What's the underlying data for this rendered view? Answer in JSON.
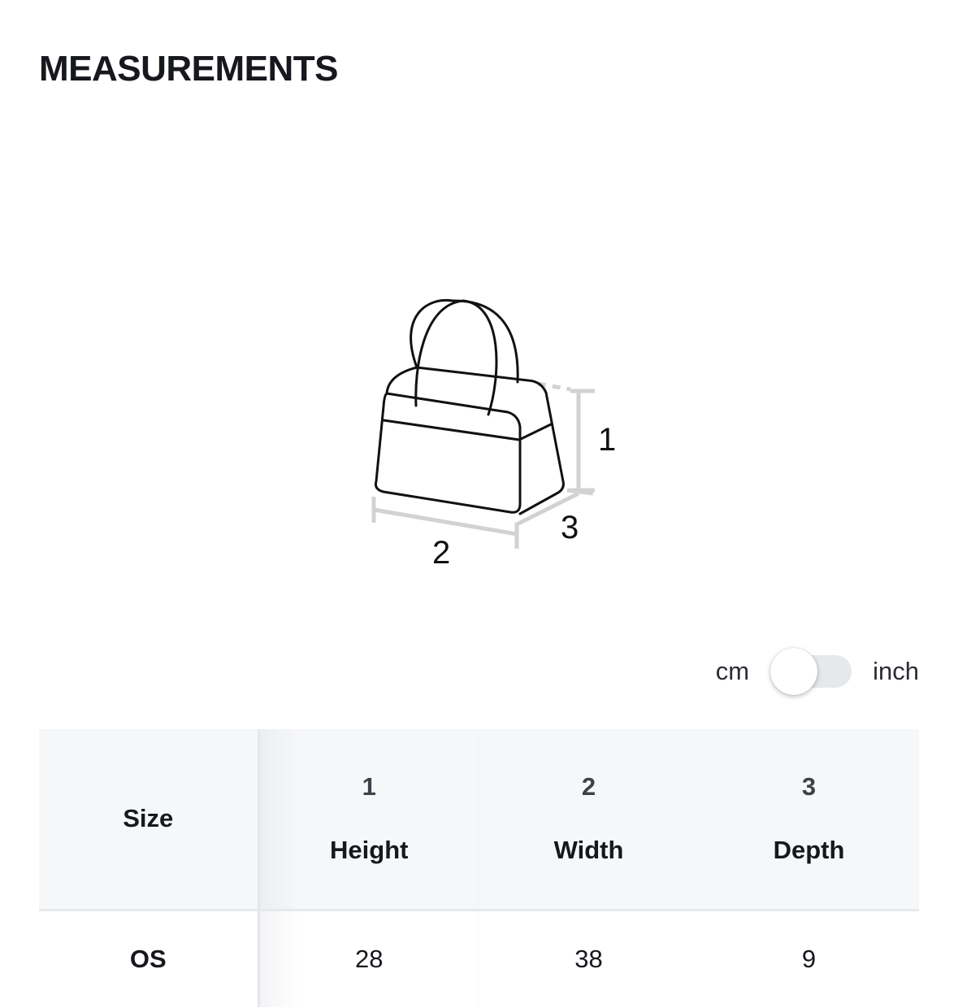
{
  "title": "MEASUREMENTS",
  "illustration": {
    "icon": "handbag-dimensions-icon",
    "labels": {
      "height": "1",
      "width": "2",
      "depth": "3"
    }
  },
  "unit_toggle": {
    "left_label": "cm",
    "right_label": "inch",
    "selected": "cm"
  },
  "table": {
    "size_header": "Size",
    "columns": [
      {
        "number": "1",
        "name": "Height"
      },
      {
        "number": "2",
        "name": "Width"
      },
      {
        "number": "3",
        "name": "Depth"
      }
    ],
    "rows": [
      {
        "size": "OS",
        "values": [
          "28",
          "38",
          "9"
        ]
      }
    ]
  },
  "colors": {
    "text": "#16181d",
    "header_background": "#f6f7f9",
    "dimension_lines": "#d0d0d0",
    "toggle_track": "#e6e8ec"
  }
}
